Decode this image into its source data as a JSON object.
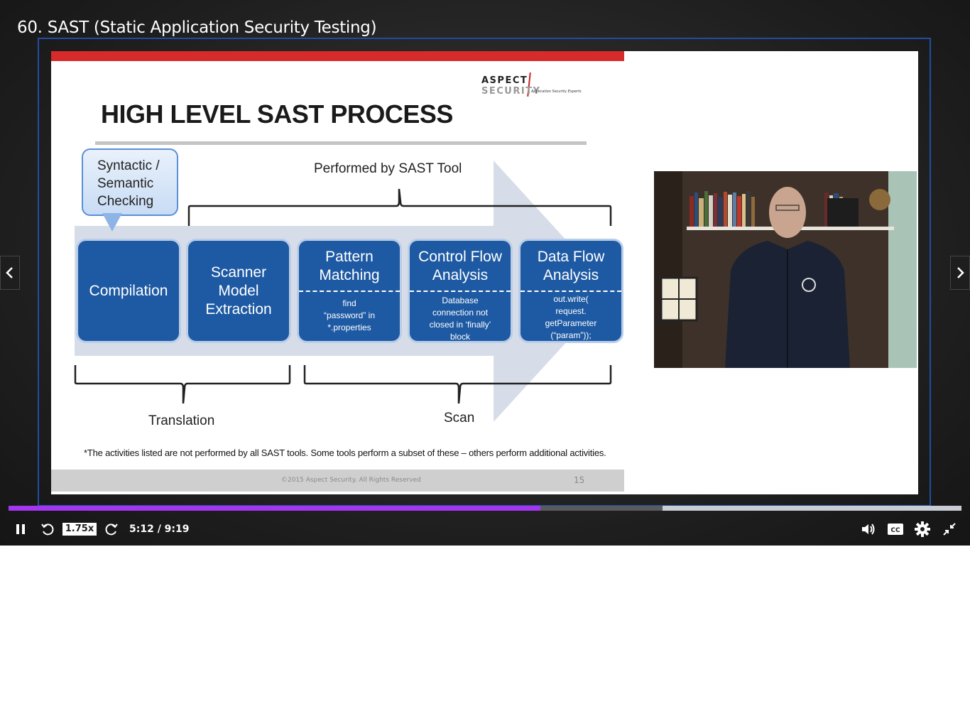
{
  "video": {
    "title": "60. SAST (Static Application Security Testing)"
  },
  "slide": {
    "logo_primary": "ASPECT",
    "logo_secondary": "SECURITY",
    "logo_tagline": "Application Security Experts",
    "heading": "HIGH LEVEL SAST PROCESS",
    "callout_lines": [
      "Syntactic /",
      "Semantic",
      "Checking"
    ],
    "performed_by_label": "Performed by SAST Tool",
    "steps": [
      {
        "title": [
          "Compilation"
        ],
        "detail": []
      },
      {
        "title": [
          "Scanner",
          "Model",
          "Extraction"
        ],
        "detail": []
      },
      {
        "title": [
          "Pattern",
          "Matching"
        ],
        "detail": [
          "find",
          "“password” in",
          "*.properties"
        ]
      },
      {
        "title": [
          "Control Flow",
          "Analysis"
        ],
        "detail": [
          "Database",
          "connection not",
          "closed in ‘finally’",
          "block"
        ]
      },
      {
        "title": [
          "Data Flow",
          "Analysis"
        ],
        "detail": [
          "out.write(",
          "request.",
          "getParameter",
          "(“param”));"
        ]
      }
    ],
    "translation_label": "Translation",
    "scan_label": "Scan",
    "footnote": "*The activities listed are not performed by all SAST tools. Some tools perform a subset of these – others perform additional activities.",
    "copyright": "©2015 Aspect Security. All Rights Reserved",
    "page_number": "15"
  },
  "player": {
    "speed": "1.75x",
    "time": "5:12 / 9:19",
    "progress_fraction": 0.558,
    "buffered_fraction": 0.686,
    "accent_color": "#a435f0",
    "icons": [
      "pause-icon",
      "rewind-icon",
      "forward-icon",
      "volume-icon",
      "captions-icon",
      "settings-icon",
      "exit-fullscreen-icon",
      "chevron-left-icon",
      "chevron-right-icon"
    ],
    "captions_label": "CC"
  }
}
